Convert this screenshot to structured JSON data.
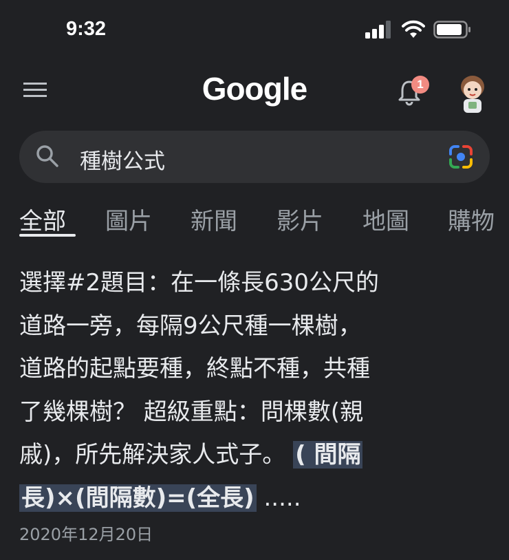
{
  "status_bar": {
    "time": "9:32",
    "icons": [
      "signal-icon",
      "wifi-icon",
      "battery-icon"
    ]
  },
  "header": {
    "logo": "Google",
    "notification_count": "1",
    "icons": [
      "menu-icon",
      "bell-icon",
      "avatar"
    ]
  },
  "search": {
    "query": "種樹公式",
    "icons": [
      "search-icon",
      "google-lens-icon"
    ]
  },
  "tabs": [
    {
      "label": "全部",
      "active": true
    },
    {
      "label": "圖片",
      "active": false
    },
    {
      "label": "新聞",
      "active": false
    },
    {
      "label": "影片",
      "active": false
    },
    {
      "label": "地圖",
      "active": false
    },
    {
      "label": "購物",
      "active": false
    }
  ],
  "result": {
    "snippet_lines": [
      "選擇#2題目：在一條長630公尺的",
      "道路一旁，每隔9公尺種一棵樹，",
      "道路的起點要種，終點不種，共種",
      "了幾棵樹？ 超級重點：問棵數(親",
      "戚)，所先解決家人式子。"
    ],
    "highlight_part1": "( 間隔",
    "highlight_part2": "長)×(間隔數)=(全長)",
    "ellipsis": " .....",
    "date": "2020年12月20日"
  },
  "colors": {
    "background": "#202124",
    "search_bar": "#303134",
    "highlight": "#394457",
    "muted_text": "#9aa0a6",
    "badge": "#f28b82"
  }
}
